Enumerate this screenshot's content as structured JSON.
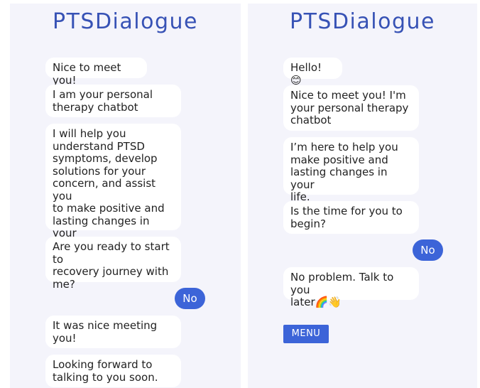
{
  "left": {
    "title": "PTSDialogue",
    "messages": [
      "Nice to meet you!",
      "I am your personal\ntherapy chatbot",
      "I will help you\nunderstand PTSD\nsymptoms, develop\nsolutions for your\nconcern, and assist you\nto make positive and\nlasting changes in your\nlife",
      "Are you ready to start to\nrecovery journey with\nme?",
      "It was nice meeting\nyou!",
      "Looking forward to\ntalking to you soon."
    ],
    "user_reply": "No"
  },
  "right": {
    "title": "PTSDialogue",
    "messages": [
      "Hello! 😊",
      "Nice to meet you! I'm\nyour personal therapy\nchatbot",
      "I’m here to help you\nmake positive and\nlasting changes in your\nlife.",
      "Is the time for you to\nbegin?",
      "No problem. Talk to you\nlater🌈👋"
    ],
    "user_reply": "No",
    "menu_label": "MENU"
  },
  "colors": {
    "accent": "#3c64d8",
    "title": "#3752b5",
    "panel_bg": "#f4f4fb",
    "bubble_bg": "#ffffff"
  }
}
